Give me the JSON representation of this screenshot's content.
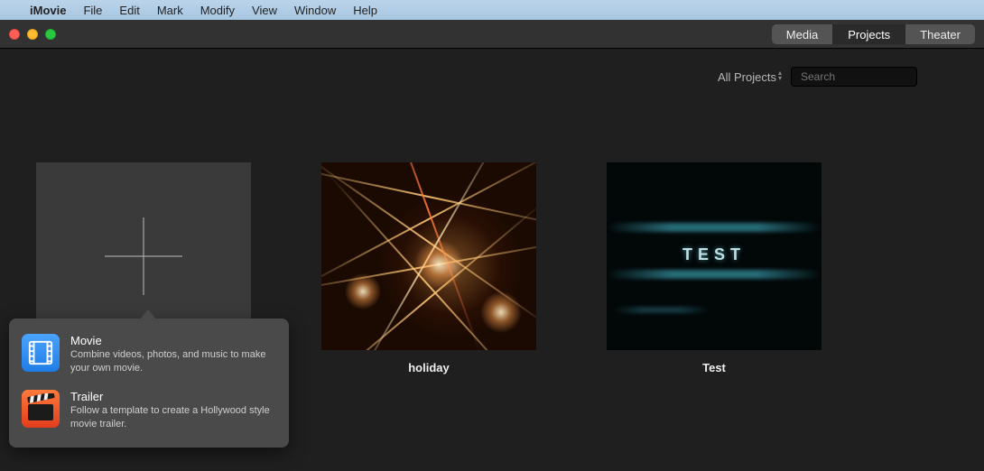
{
  "menubar": {
    "app_name": "iMovie",
    "items": [
      "File",
      "Edit",
      "Mark",
      "Modify",
      "View",
      "Window",
      "Help"
    ]
  },
  "segmented": {
    "media": "Media",
    "projects": "Projects",
    "theater": "Theater"
  },
  "filter": {
    "label": "All Projects"
  },
  "search": {
    "placeholder": "Search"
  },
  "projects": [
    {
      "title": "holiday",
      "thumb_text": ""
    },
    {
      "title": "Test",
      "thumb_text": "TEST"
    }
  ],
  "popover": {
    "movie": {
      "title": "Movie",
      "desc": "Combine videos, photos, and music to make your own movie."
    },
    "trailer": {
      "title": "Trailer",
      "desc": "Follow a template to create a Hollywood style movie trailer."
    }
  }
}
